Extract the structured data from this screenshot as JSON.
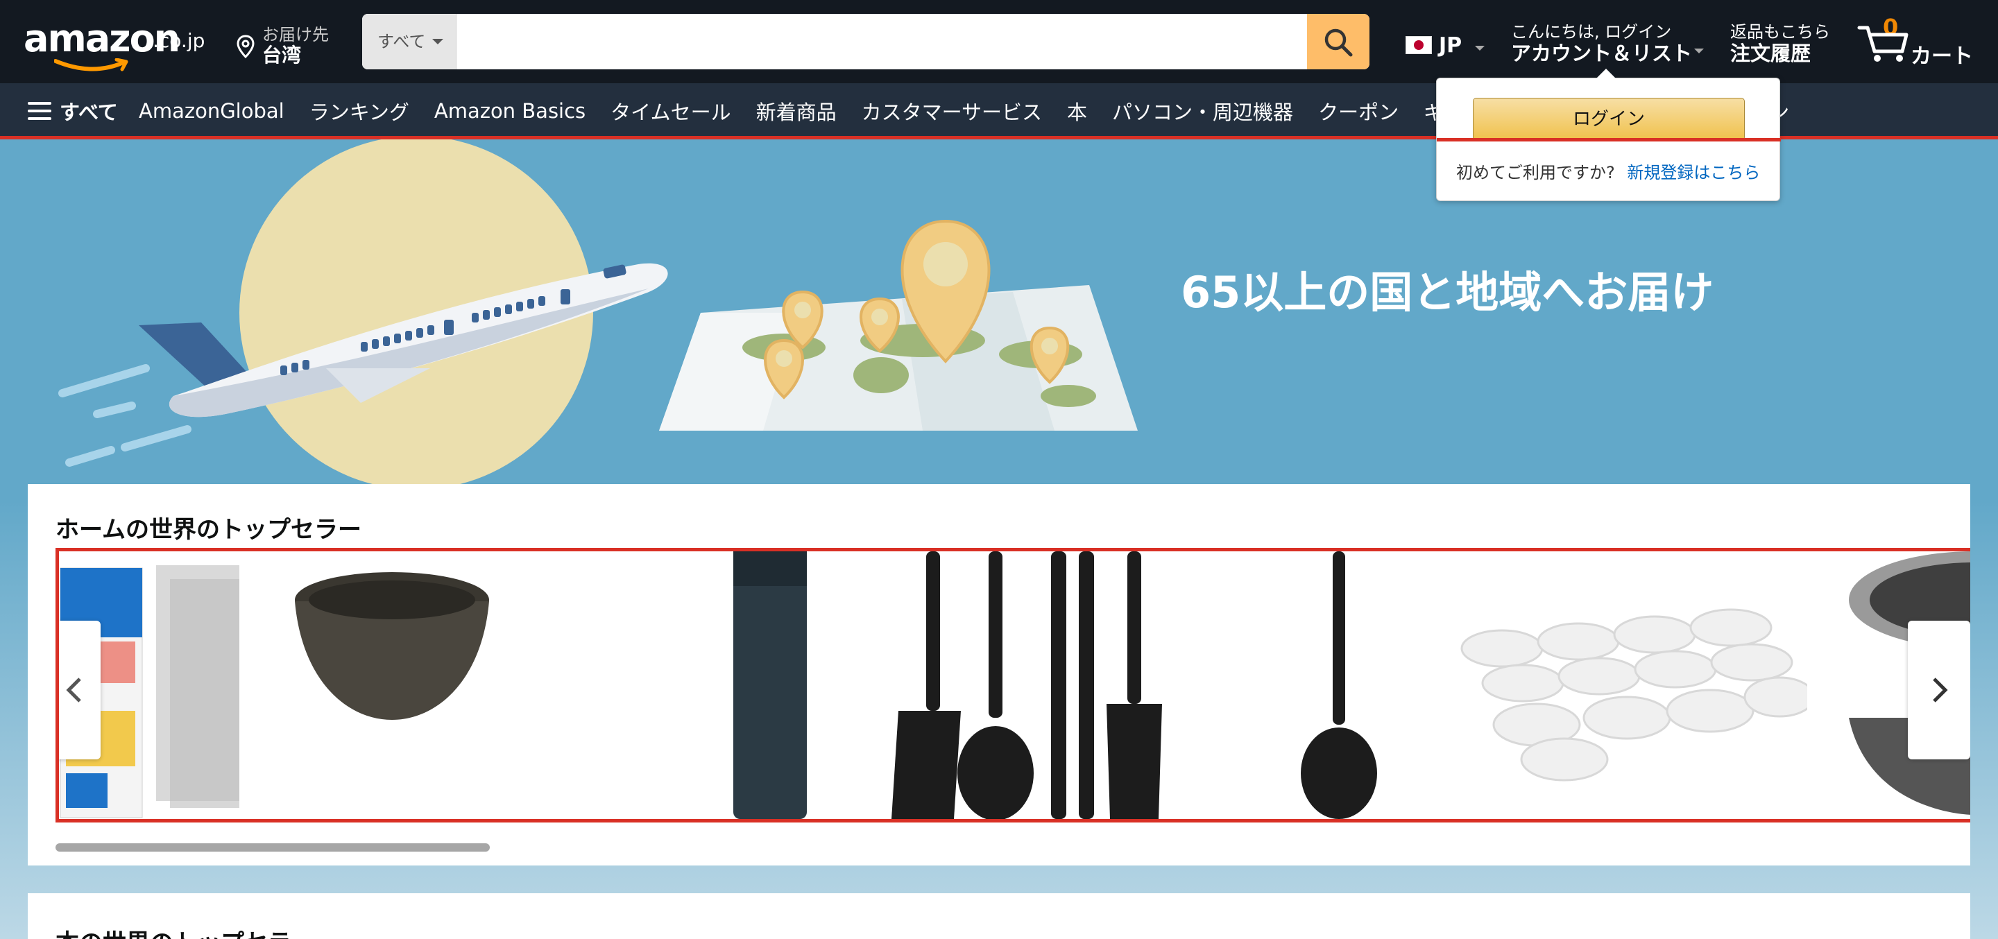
{
  "header": {
    "logo_text": "amazon",
    "logo_tld": ".co.jp",
    "deliver_label": "お届け先",
    "deliver_location": "台湾",
    "search_category": "すべて",
    "search_placeholder": "",
    "lang_code": "JP",
    "account_greeting": "こんにちは, ログイン",
    "account_label": "アカウント＆リスト",
    "orders_line1": "返品もこちら",
    "orders_line2": "注文履歴",
    "cart_count": "0",
    "cart_label": "カート"
  },
  "nav": {
    "all_label": "すべて",
    "items": [
      "AmazonGlobal",
      "ランキング",
      "Amazon Basics",
      "タイムセール",
      "新着商品",
      "カスタマーサービス",
      "本",
      "パソコン・周辺機器",
      "クーポン",
      "ギフト",
      "チン"
    ]
  },
  "popover": {
    "login_label": "ログイン",
    "new_customer_text": "初めてご利用ですか?",
    "register_link": "新規登録はこちら"
  },
  "hero": {
    "title": "65以上の国と地域へお届け"
  },
  "bestsellers": {
    "title": "ホームの世界のトップセラー",
    "products": [
      "window-insulation-panel",
      "ceramic-bowl",
      "vacuum-bottle",
      "kitchen-utensil-set",
      "serving-spoon",
      "plastic-containers",
      "steel-pot"
    ]
  },
  "second_section": {
    "title": "本の世界のトップセラー"
  },
  "colors": {
    "header_bg": "#131921",
    "nav_bg": "#232f3e",
    "search_button": "#febd69",
    "cart_count": "#f08804",
    "hero_bg": "#62a8c9",
    "highlight_red": "#d93025",
    "link_blue": "#0066c0"
  }
}
